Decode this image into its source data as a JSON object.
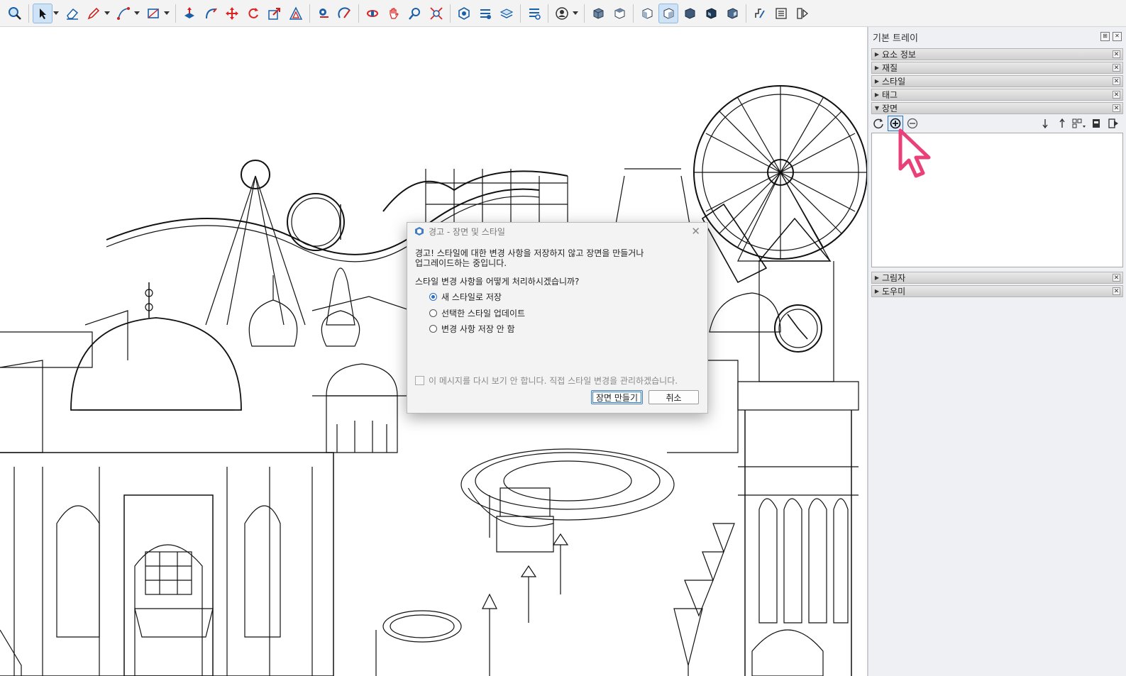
{
  "toolbar": {
    "tools": [
      "zoom-tool",
      "select-tool",
      "eraser-tool",
      "pencil-tool",
      "arc-tool",
      "rectangle-tool",
      "push-pull-tool",
      "follow-me-tool",
      "move-tool",
      "rotate-tool",
      "scale-tool",
      "offset-tool",
      "tape-measure-tool",
      "protractor-tool",
      "section-plane-tool",
      "walk-tool",
      "look-around-tool",
      "zoom-window-tool",
      "zoom-extents-tool",
      "warehouse-tool",
      "extension-tool",
      "layers-tool",
      "styles-tool",
      "account-tool",
      "iso-view",
      "top-view",
      "front-view",
      "right-view",
      "back-view",
      "left-view",
      "bottom-view",
      "model-info-tool",
      "outliner-tool",
      "components-tool"
    ]
  },
  "tray": {
    "title": "기본 트레이",
    "panels_top": [
      {
        "label": "요소 정보",
        "expanded": false
      },
      {
        "label": "재질",
        "expanded": false
      },
      {
        "label": "스타일",
        "expanded": false
      },
      {
        "label": "태그",
        "expanded": false
      },
      {
        "label": "장면",
        "expanded": true
      }
    ],
    "panels_bottom": [
      {
        "label": "그림자",
        "expanded": false
      },
      {
        "label": "도우미",
        "expanded": false
      }
    ]
  },
  "dialog": {
    "title": "경고 - 장면 및 스타일",
    "message_line1": "경고! 스타일에 대한 변경 사항을 저장하지 않고 장면을 만들거나",
    "message_line2": "업그레이드하는 중입니다.",
    "question": "스타일 변경 사항을 어떻게 처리하시겠습니까?",
    "options": [
      {
        "label": "새 스타일로 저장",
        "selected": true
      },
      {
        "label": "선택한 스타일 업데이트",
        "selected": false
      },
      {
        "label": "변경 사항 저장 안 함",
        "selected": false
      }
    ],
    "dont_show": "이 메시지를 다시 보기 안 합니다.  직접 스타일 변경을 관리하겠습니다.",
    "create_button": "장면 만들기",
    "cancel_button": "취소"
  },
  "colors": {
    "accent": "#2c6fbf",
    "cursor": "#e8417a"
  }
}
